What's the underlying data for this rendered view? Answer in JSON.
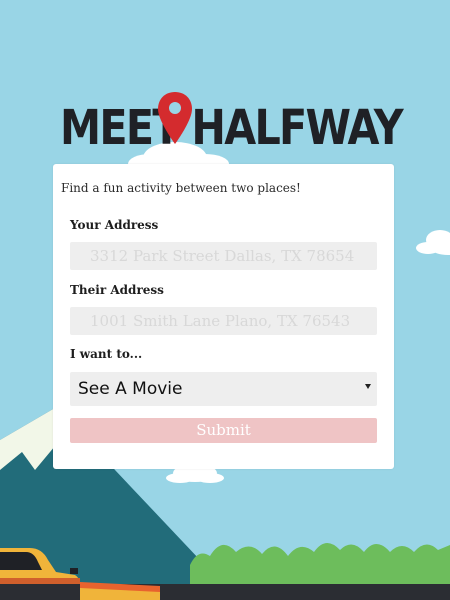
{
  "logo": {
    "text": "MEET HALFWAY",
    "pin_color": "#d42b2e",
    "text_color": "#1f2126"
  },
  "form": {
    "tagline": "Find a fun activity between two places!",
    "your_address": {
      "label": "Your Address",
      "placeholder": "3312 Park Street Dallas, TX 78654"
    },
    "their_address": {
      "label": "Their Address",
      "placeholder": "1001 Smith Lane Plano, TX 76543"
    },
    "activity": {
      "label": "I want to...",
      "selected": "See A Movie"
    },
    "submit_label": "Submit",
    "submit_color": "#efc4c5"
  },
  "scene": {
    "sky_color": "#99d5e6",
    "mountain_color": "#226c7a",
    "snow_color": "#f2f7e8",
    "grass_color": "#6dbd5c",
    "road_color": "#2b2d33",
    "car_color": "#f0b43a"
  }
}
